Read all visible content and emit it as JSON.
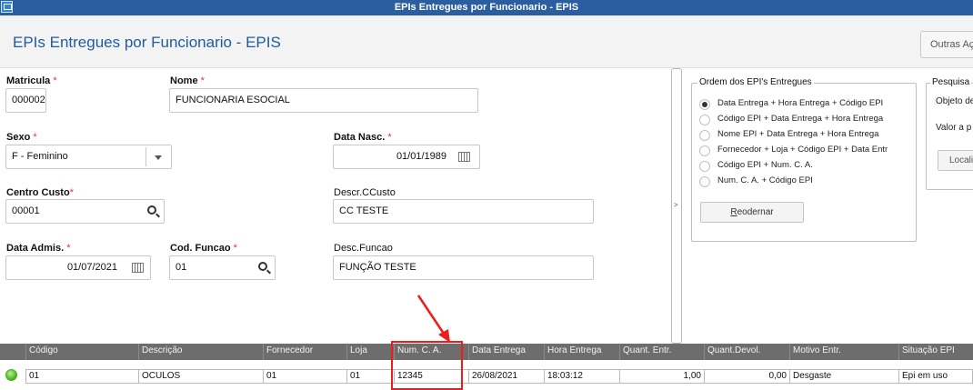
{
  "window": {
    "title": "EPIs Entregues por Funcionario - EPIS"
  },
  "header": {
    "title": "EPIs Entregues por Funcionario - EPIS",
    "more_actions_label": "Outras Ações"
  },
  "form": {
    "matricula": {
      "label": "Matricula",
      "value": "000002"
    },
    "nome": {
      "label": "Nome",
      "value": "FUNCIONARIA ESOCIAL"
    },
    "sexo": {
      "label": "Sexo",
      "value": "F - Feminino"
    },
    "data_nasc": {
      "label": "Data Nasc.",
      "value": "01/01/1989"
    },
    "centro_custo": {
      "label": "Centro Custo",
      "value": "00001"
    },
    "descr_ccusto": {
      "label": "Descr.CCusto",
      "value": "CC TESTE"
    },
    "data_admis": {
      "label": "Data Admis.",
      "value": "01/07/2021"
    },
    "cod_funcao": {
      "label": "Cod. Funcao",
      "value": "01"
    },
    "desc_funcao": {
      "label": "Desc.Funcao",
      "value": "FUNÇÃO TESTE"
    },
    "required_mark": "*"
  },
  "splitter": {
    "glyph": ">"
  },
  "ordem": {
    "title": "Ordem dos EPI's Entregues",
    "options": [
      "Data Entrega + Hora Entrega + Código EPI",
      "Código EPI + Data Entrega + Hora Entrega",
      "Nome EPI + Data Entrega + Hora Entrega",
      "Fornecedor + Loja + Código EPI + Data Entr",
      "Código EPI +  Num. C. A.",
      "Num. C. A. + Código EPI"
    ],
    "selected_index": 0,
    "reorder_button": "Reodernar"
  },
  "pesquisa": {
    "title": "Pesquisa",
    "objeto_label": "Objeto de",
    "valor_label": "Valor a p",
    "button": "Locali"
  },
  "grid": {
    "columns": [
      "Código",
      "Descrição",
      "Fornecedor",
      "Loja",
      "Num. C. A.",
      "Data Entrega",
      "Hora Entrega",
      "Quant. Entr.",
      "Quant.Devol.",
      "Motivo Entr.",
      "Situação EPI"
    ],
    "rows": [
      [
        "01",
        "OCULOS",
        "01",
        "01",
        "12345",
        "26/08/2021",
        "18:03:12",
        "1,00",
        "0,00",
        "Desgaste",
        "Epi em uso"
      ]
    ],
    "status_color": "#48b11d"
  },
  "annotation": {
    "color": "#ee1c1c",
    "highlighted_column": "Num. C. A."
  }
}
